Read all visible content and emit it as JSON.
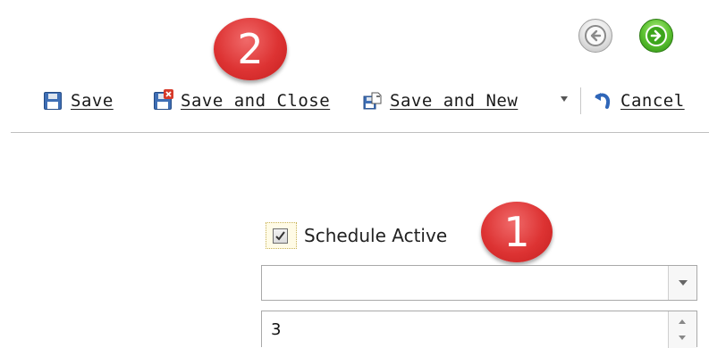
{
  "navigation": {
    "back_icon": "arrow-left-icon",
    "forward_icon": "arrow-right-icon",
    "forward_color": "#4cb82a"
  },
  "badges": [
    {
      "label": "2",
      "color": "#dd3333"
    },
    {
      "label": "1",
      "color": "#dd3333"
    }
  ],
  "toolbar": {
    "save_label": "Save",
    "save_close_label": "Save and Close",
    "save_new_label": "Save and New",
    "cancel_label": "Cancel",
    "icons": [
      "floppy-disk-icon",
      "floppy-disk-close-icon",
      "save-new-icon",
      "undo-icon"
    ]
  },
  "form": {
    "schedule_active": {
      "label": "Schedule Active",
      "checked": true
    },
    "dropdown": {
      "value": ""
    },
    "number_field": {
      "value": "3"
    }
  }
}
